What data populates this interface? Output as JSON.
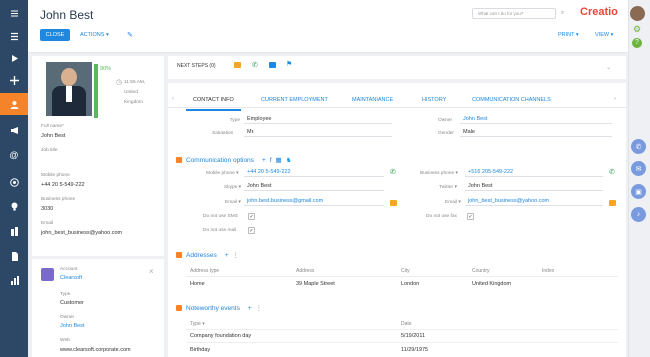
{
  "header": {
    "title": "John Best",
    "close_label": "CLOSE",
    "actions_label": "ACTIONS ▾",
    "search_placeholder": "What can I do for you?",
    "logo": "Creatio",
    "print_label": "PRINT ▾",
    "view_label": "VIEW ▾"
  },
  "profile": {
    "completeness": "90%",
    "time": "11:55 AM,",
    "location1": "United",
    "location2": "Kingdom",
    "full_name_label": "Full name*",
    "full_name": "John Best",
    "job_title_label": "Job title",
    "mobile_label": "Mobile phone",
    "mobile": "+44 20 5-549-222",
    "business_label": "Business phone",
    "business": "3030",
    "email_label": "Email",
    "email": "john_best_business@yahoo.com"
  },
  "account": {
    "account_label": "Account",
    "account": "Clearsoft",
    "type_label": "Type",
    "type": "Customer",
    "owner_label": "Owner",
    "owner": "John Best",
    "web_label": "Web",
    "web": "www.clearsoft.corporate.com"
  },
  "next_steps": "NEXT STEPS (0)",
  "tabs": [
    "CONTACT INFO",
    "CURRENT EMPLOYMENT",
    "MAINTANIANCE",
    "HISTORY",
    "COMMUNICATION CHANNELS"
  ],
  "contact": {
    "type_label": "Type",
    "type": "Employee",
    "salutation_label": "Salutation",
    "salutation": "Mr.",
    "owner_label": "Owner",
    "owner": "John Best",
    "gender_label": "Gender",
    "gender": "Male"
  },
  "comm": {
    "title": "Communication options",
    "mobile_label": "Mobile phone ▾",
    "mobile": "+44 20 5-549-222",
    "business_label": "Business phone ▾",
    "business": "+516 205-549-222",
    "skype_label": "Skype ▾",
    "skype": "John Best",
    "twitter_label": "Twitter ▾",
    "twitter": "John Best",
    "email1_label": "Email ▾",
    "email1": "john.best.business@gmail.com",
    "email2_label": "Email ▾",
    "email2": "john_best_business@yahoo.com",
    "sms_label": "Do not use SMS",
    "fax_label": "Do not use fax",
    "mail_label": "Do not use mail"
  },
  "addresses": {
    "title": "Addresses",
    "headers": [
      "Address type",
      "Address",
      "City",
      "Country",
      "Index"
    ],
    "rows": [
      [
        "Home",
        "39 Maple Street",
        "London",
        "United Kingdom",
        ""
      ]
    ]
  },
  "events": {
    "title": "Noteworthy events",
    "headers": [
      "Type ▾",
      "Date"
    ],
    "rows": [
      [
        "Company foundation day",
        "5/19/2011"
      ],
      [
        "Birthday",
        "11/29/1975"
      ]
    ]
  },
  "colors": {
    "accent": "#1e87e0",
    "orange": "#f5832a",
    "nav": "#2c4866"
  }
}
